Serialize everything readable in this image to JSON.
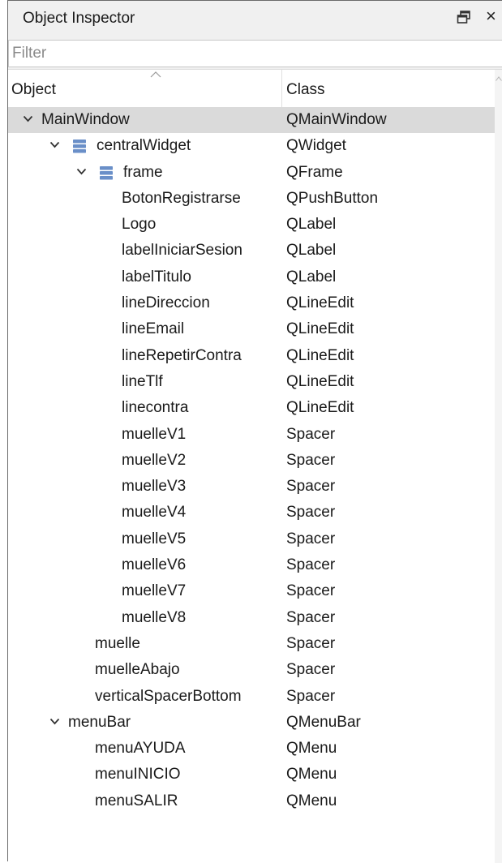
{
  "panel": {
    "title": "Object Inspector",
    "float_icon": "float-window-icon",
    "close_label": "×"
  },
  "filter": {
    "placeholder": "Filter",
    "value": ""
  },
  "columns": {
    "object": "Object",
    "class": "Class"
  },
  "colors": {
    "selected_row": "#dadada",
    "widget_icon": "#6a8fc8"
  },
  "rows": [
    {
      "name": "MainWindow",
      "class": "QMainWindow",
      "depth": 0,
      "expander": true,
      "icon": "none",
      "selected": true
    },
    {
      "name": "centralWidget",
      "class": "QWidget",
      "depth": 1,
      "expander": true,
      "icon": "layout-icon",
      "selected": false
    },
    {
      "name": "frame",
      "class": "QFrame",
      "depth": 2,
      "expander": true,
      "icon": "layout-icon",
      "selected": false
    },
    {
      "name": "BotonRegistrarse",
      "class": "QPushButton",
      "depth": 3,
      "expander": false,
      "icon": "none",
      "selected": false
    },
    {
      "name": "Logo",
      "class": "QLabel",
      "depth": 3,
      "expander": false,
      "icon": "none",
      "selected": false
    },
    {
      "name": "labelIniciarSesion",
      "class": "QLabel",
      "depth": 3,
      "expander": false,
      "icon": "none",
      "selected": false
    },
    {
      "name": "labelTitulo",
      "class": "QLabel",
      "depth": 3,
      "expander": false,
      "icon": "none",
      "selected": false
    },
    {
      "name": "lineDireccion",
      "class": "QLineEdit",
      "depth": 3,
      "expander": false,
      "icon": "none",
      "selected": false
    },
    {
      "name": "lineEmail",
      "class": "QLineEdit",
      "depth": 3,
      "expander": false,
      "icon": "none",
      "selected": false
    },
    {
      "name": "lineRepetirContra",
      "class": "QLineEdit",
      "depth": 3,
      "expander": false,
      "icon": "none",
      "selected": false
    },
    {
      "name": "lineTlf",
      "class": "QLineEdit",
      "depth": 3,
      "expander": false,
      "icon": "none",
      "selected": false
    },
    {
      "name": "linecontra",
      "class": "QLineEdit",
      "depth": 3,
      "expander": false,
      "icon": "none",
      "selected": false
    },
    {
      "name": "muelleV1",
      "class": "Spacer",
      "depth": 3,
      "expander": false,
      "icon": "none",
      "selected": false
    },
    {
      "name": "muelleV2",
      "class": "Spacer",
      "depth": 3,
      "expander": false,
      "icon": "none",
      "selected": false
    },
    {
      "name": "muelleV3",
      "class": "Spacer",
      "depth": 3,
      "expander": false,
      "icon": "none",
      "selected": false
    },
    {
      "name": "muelleV4",
      "class": "Spacer",
      "depth": 3,
      "expander": false,
      "icon": "none",
      "selected": false
    },
    {
      "name": "muelleV5",
      "class": "Spacer",
      "depth": 3,
      "expander": false,
      "icon": "none",
      "selected": false
    },
    {
      "name": "muelleV6",
      "class": "Spacer",
      "depth": 3,
      "expander": false,
      "icon": "none",
      "selected": false
    },
    {
      "name": "muelleV7",
      "class": "Spacer",
      "depth": 3,
      "expander": false,
      "icon": "none",
      "selected": false
    },
    {
      "name": "muelleV8",
      "class": "Spacer",
      "depth": 3,
      "expander": false,
      "icon": "none",
      "selected": false
    },
    {
      "name": "muelle",
      "class": "Spacer",
      "depth": 2,
      "expander": false,
      "icon": "none",
      "selected": false
    },
    {
      "name": "muelleAbajo",
      "class": "Spacer",
      "depth": 2,
      "expander": false,
      "icon": "none",
      "selected": false
    },
    {
      "name": "verticalSpacerBottom",
      "class": "Spacer",
      "depth": 2,
      "expander": false,
      "icon": "none",
      "selected": false
    },
    {
      "name": "menuBar",
      "class": "QMenuBar",
      "depth": 1,
      "expander": true,
      "icon": "none",
      "selected": false
    },
    {
      "name": "menuAYUDA",
      "class": "QMenu",
      "depth": 2,
      "expander": false,
      "icon": "none",
      "selected": false
    },
    {
      "name": "menuINICIO",
      "class": "QMenu",
      "depth": 2,
      "expander": false,
      "icon": "none",
      "selected": false
    },
    {
      "name": "menuSALIR",
      "class": "QMenu",
      "depth": 2,
      "expander": false,
      "icon": "none",
      "selected": false
    }
  ]
}
